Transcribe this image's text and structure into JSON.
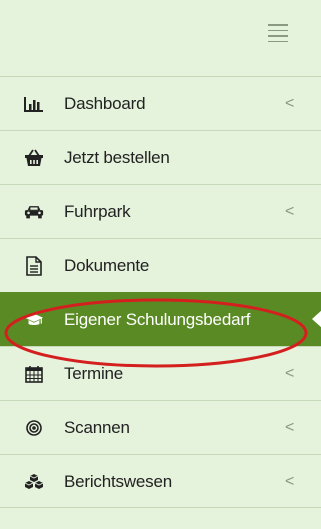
{
  "menu": {
    "items": [
      {
        "label": "Dashboard",
        "icon": "bar-chart-icon",
        "has_submenu": true
      },
      {
        "label": "Jetzt bestellen",
        "icon": "basket-icon",
        "has_submenu": false
      },
      {
        "label": "Fuhrpark",
        "icon": "car-icon",
        "has_submenu": true
      },
      {
        "label": "Dokumente",
        "icon": "document-icon",
        "has_submenu": false
      },
      {
        "label": "Eigener Schulungsbedarf",
        "icon": "graduation-cap-icon",
        "has_submenu": false,
        "active": true
      },
      {
        "label": "Termine",
        "icon": "calendar-icon",
        "has_submenu": true
      },
      {
        "label": "Scannen",
        "icon": "target-icon",
        "has_submenu": true
      },
      {
        "label": "Berichtswesen",
        "icon": "cubes-icon",
        "has_submenu": true
      }
    ],
    "chevron": "<"
  },
  "colors": {
    "sidebar_bg": "#e5f2dc",
    "active_bg": "#5a8a23",
    "annotation": "#d41f1f"
  }
}
